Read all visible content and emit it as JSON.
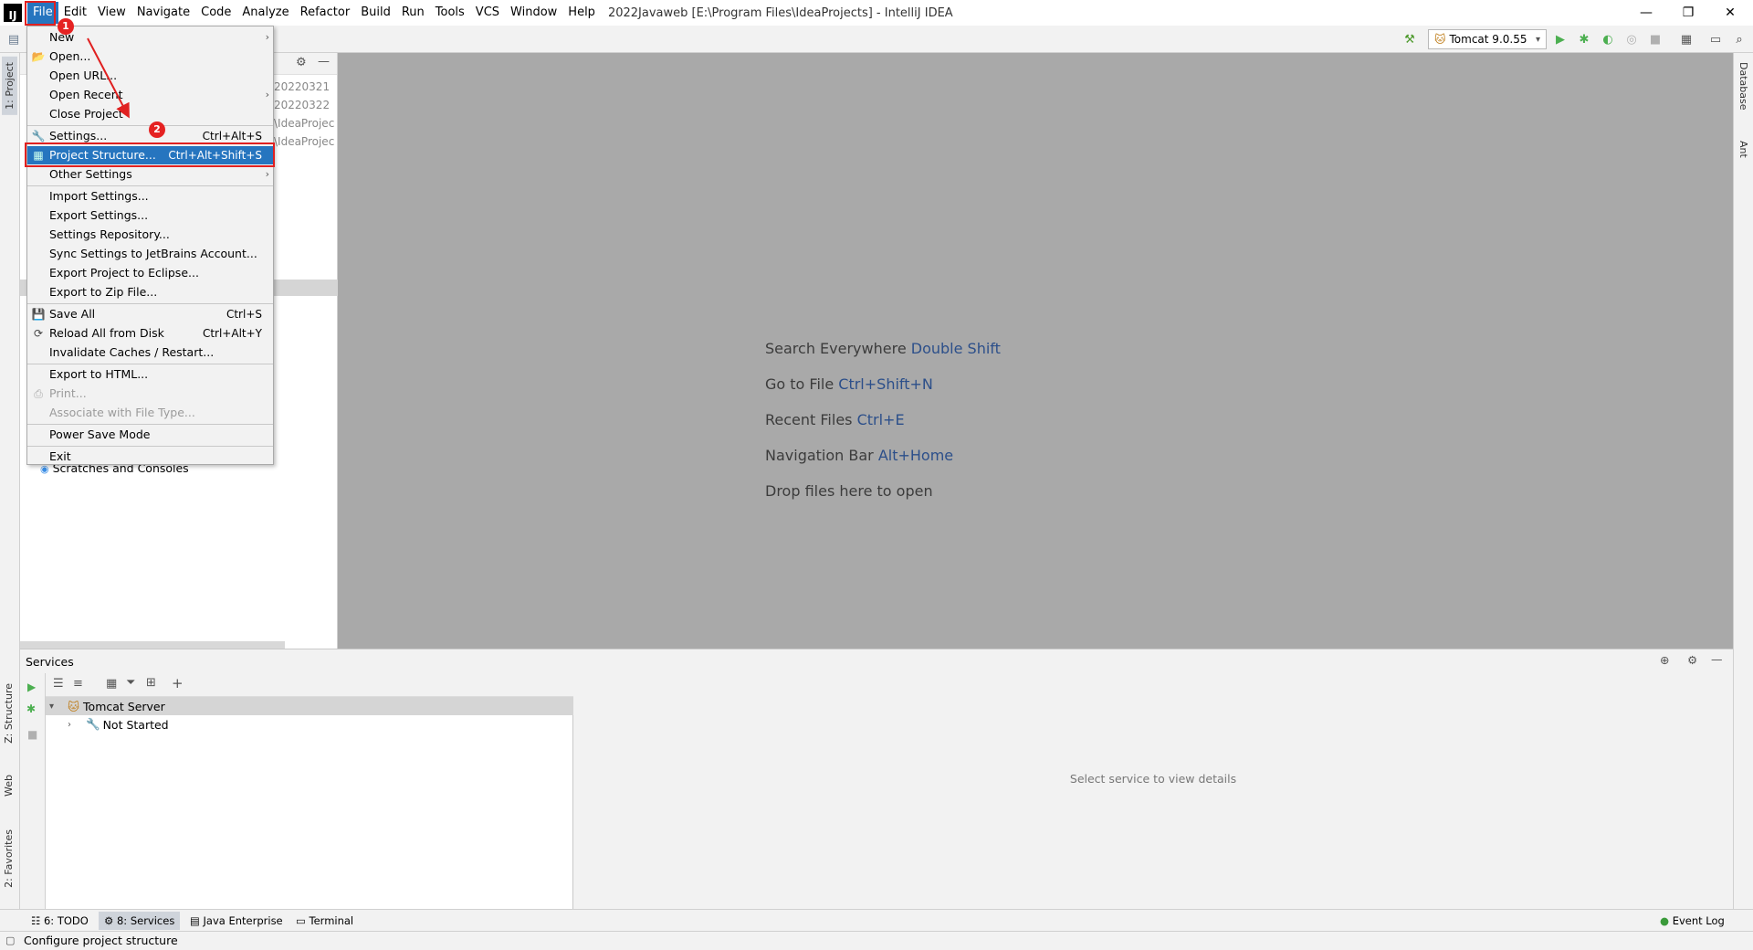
{
  "menubar": {
    "logo": "IJ",
    "items": [
      "File",
      "Edit",
      "View",
      "Navigate",
      "Code",
      "Analyze",
      "Refactor",
      "Build",
      "Run",
      "Tools",
      "VCS",
      "Window",
      "Help"
    ],
    "window_title": "2022Javaweb [E:\\Program Files\\IdeaProjects] - IntelliJ IDEA"
  },
  "window_controls": {
    "minimize": "—",
    "restore": "❐",
    "close": "✕"
  },
  "toolbar": {
    "run_config": "Tomcat 9.0.55"
  },
  "left_strip": {
    "project": "1: Project",
    "structure": "Z: Structure",
    "web": "Web",
    "favorites": "2: Favorites"
  },
  "right_strip": {
    "database": "Database",
    "ant": "Ant"
  },
  "project_tree": {
    "rows": [
      "20220321",
      "20220322",
      "\\IdeaProjec",
      "\\IdeaProjec"
    ],
    "scratches": "Scratches and Consoles"
  },
  "editor_hints": [
    {
      "text": "Search Everywhere ",
      "key": "Double Shift"
    },
    {
      "text": "Go to File ",
      "key": "Ctrl+Shift+N"
    },
    {
      "text": "Recent Files ",
      "key": "Ctrl+E"
    },
    {
      "text": "Navigation Bar ",
      "key": "Alt+Home"
    },
    {
      "text": "Drop files here to open",
      "key": ""
    }
  ],
  "file_menu": {
    "new": "New",
    "open": "Open...",
    "open_url": "Open URL...",
    "open_recent": "Open Recent",
    "close_project": "Close Project",
    "settings": "Settings...",
    "settings_sc": "Ctrl+Alt+S",
    "project_structure": "Project Structure...",
    "project_structure_sc": "Ctrl+Alt+Shift+S",
    "other_settings": "Other Settings",
    "import_settings": "Import Settings...",
    "export_settings": "Export Settings...",
    "settings_repository": "Settings Repository...",
    "sync_settings": "Sync Settings to JetBrains Account...",
    "export_eclipse": "Export Project to Eclipse...",
    "export_zip": "Export to Zip File...",
    "save_all": "Save All",
    "save_all_sc": "Ctrl+S",
    "reload": "Reload All from Disk",
    "reload_sc": "Ctrl+Alt+Y",
    "invalidate": "Invalidate Caches / Restart...",
    "export_html": "Export to HTML...",
    "print": "Print...",
    "associate": "Associate with File Type...",
    "power_save": "Power Save Mode",
    "exit": "Exit"
  },
  "annotations": {
    "badge1": "1",
    "badge2": "2"
  },
  "services": {
    "title": "Services",
    "server": "Tomcat Server",
    "child": "Not Started",
    "detail_hint": "Select service to view details"
  },
  "bottom_tabs": {
    "todo": "6: TODO",
    "services": "8: Services",
    "java_enterprise": "Java Enterprise",
    "terminal": "Terminal",
    "event_log": "Event Log"
  },
  "status": {
    "text": "Configure project structure"
  },
  "colors": {
    "accent": "#2675bf",
    "annotation_red": "#e02020",
    "editor_bg": "#a9a9a9"
  }
}
